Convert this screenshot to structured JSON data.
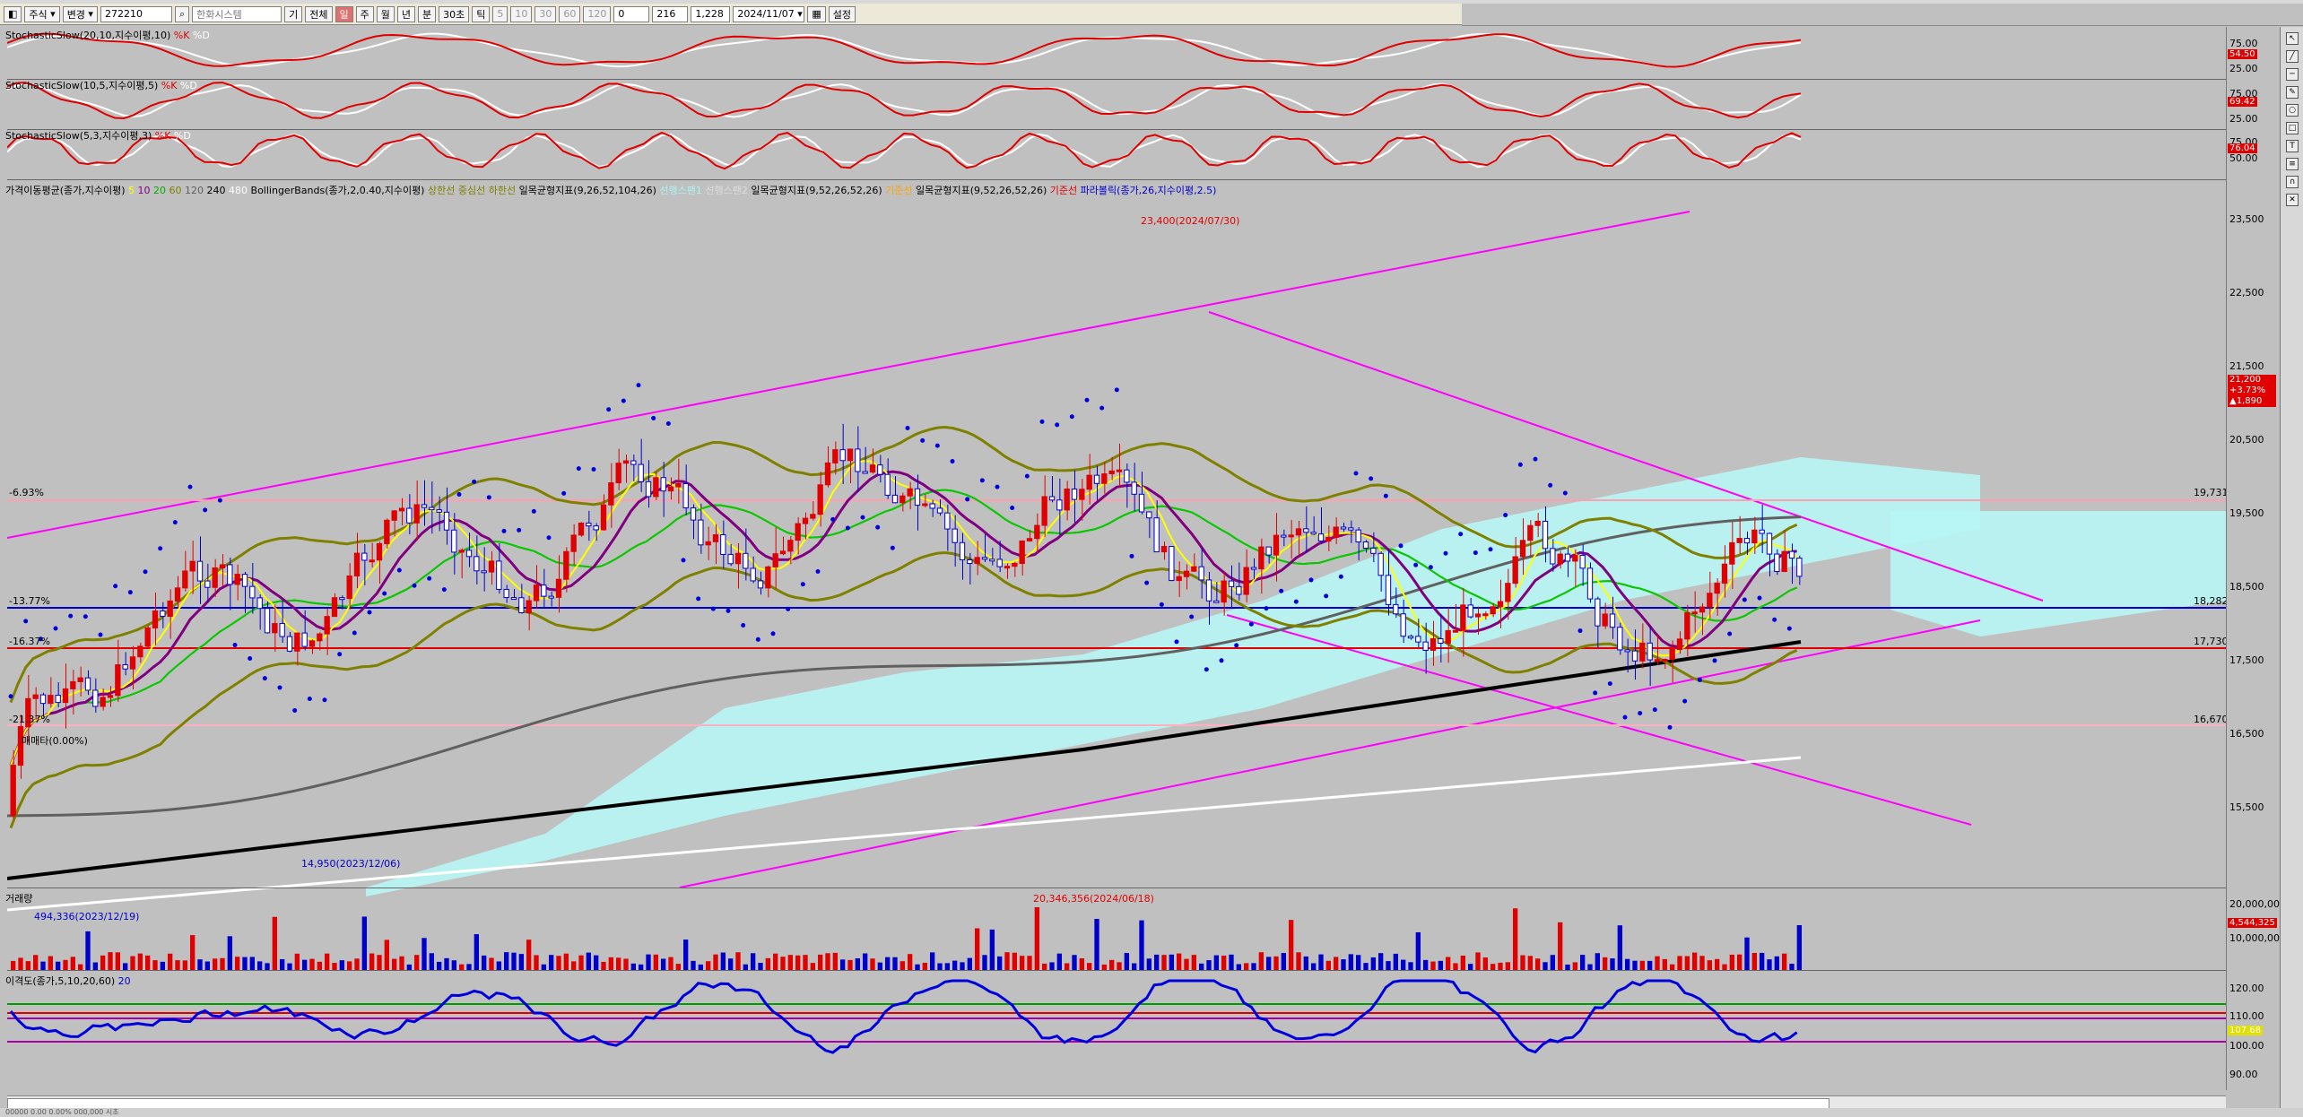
{
  "toolbar": {
    "market": "주식",
    "change": "변경",
    "code": "272210",
    "name": "한화시스템",
    "giganim": "기",
    "full": "전체",
    "periods": [
      "주",
      "월",
      "년",
      "분",
      "30초",
      "틱"
    ],
    "minutes": [
      "5",
      "10",
      "30",
      "60",
      "120"
    ],
    "count": "216",
    "ratio": "1,228",
    "date": "2024/11/07",
    "settings": "설정"
  },
  "panels": {
    "stoch1": {
      "title": "StochasticSlow(20,10,지수이평,10)",
      "k": "%K",
      "d": "%D",
      "v1": "75.00",
      "v2": "25.00",
      "badge": "54.50"
    },
    "stoch2": {
      "title": "StochasticSlow(10,5,지수이평,5)",
      "k": "%K",
      "d": "%D",
      "v1": "75.00",
      "v2": "25.00",
      "badge": "69.42"
    },
    "stoch3": {
      "title": "StochasticSlow(5,3,지수이평,3)",
      "k": "%K",
      "d": "%D",
      "v1": "75.00",
      "v2": "50.00",
      "badge": "76.04"
    },
    "price": {
      "legend": {
        "ma": "가격이동평균(종가,지수이평)",
        "ma_periods": [
          "5",
          "10",
          "20",
          "60",
          "120",
          "240",
          "480"
        ],
        "bb": "BollingerBands(종가,2,0.40,지수이평)",
        "bb_lines": [
          "상한선",
          "중심선",
          "하한선"
        ],
        "ichimoku1": "일목균형지표(9,26,52,104,26)",
        "ichimoku1_lines": [
          "선행스팬1",
          "선행스팬2"
        ],
        "ichimoku2": "일목균형지표(9,52,26,52,26)",
        "ichimoku2_line": "기준선",
        "ichimoku3": "일목균형지표(9,52,26,52,26)",
        "ichimoku3_line": "기준선",
        "sar": "파라볼릭(종가,26,지수이평,2.5)"
      },
      "y_ticks": [
        "23,500",
        "22,500",
        "21,500",
        "20,500",
        "19,500",
        "18,500",
        "17,500",
        "16,500",
        "15,500"
      ],
      "hlines": [
        {
          "pct": "-6.93%",
          "value": "19,731",
          "color": "#ff9fb0"
        },
        {
          "pct": "-13.77%",
          "value": "18,282",
          "color": "#0000cc"
        },
        {
          "pct": "-16.37%",
          "value": "17,730",
          "color": "#e00000"
        },
        {
          "pct": "-21.37%",
          "value": "16,670",
          "color": "#ffb0c0"
        }
      ],
      "high_label": "23,400(2024/07/30)",
      "low_label": "14,950(2023/12/06)",
      "start_label": "매매타(0.00%)",
      "current": {
        "price": "21,200",
        "change_pct": "+3.73%",
        "change": "▲1,890"
      }
    },
    "volume": {
      "title": "거래량",
      "max_label": "20,346,356(2024/06/18)",
      "min_label": "494,336(2023/12/19)",
      "y_ticks": [
        "20,000,000",
        "10,000,000"
      ],
      "badge": "4,544,325"
    },
    "disparity": {
      "title": "이격도(종가,5,10,20,60)",
      "period": "20",
      "y_ticks": [
        "120.00",
        "110.00",
        "100.00",
        "90.00"
      ],
      "badge": "107.68"
    }
  },
  "statusbar": {
    "left": "00000  0.00  0.00%  000,000 시초"
  }
}
